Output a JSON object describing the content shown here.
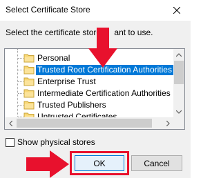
{
  "dialog": {
    "title": "Select Certificate Store",
    "instruction_before": "Select the certificate store y",
    "instruction_after": "ant to use.",
    "stores": [
      {
        "label": "Personal",
        "selected": false
      },
      {
        "label": "Trusted Root Certification Authorities",
        "selected": true
      },
      {
        "label": "Enterprise Trust",
        "selected": false
      },
      {
        "label": "Intermediate Certification Authorities",
        "selected": false
      },
      {
        "label": "Trusted Publishers",
        "selected": false
      },
      {
        "label": "Untrusted Certificates",
        "selected": false
      }
    ],
    "show_physical_label": "Show physical stores",
    "show_physical_checked": false,
    "ok_label": "OK",
    "cancel_label": "Cancel"
  },
  "colors": {
    "selection": "#0078d7",
    "annotation_red": "#e8112d",
    "folder_yellow": "#f8d775"
  },
  "icons": {
    "close": "close-icon",
    "folder": "folder-icon",
    "annotation": "arrow-annotation"
  }
}
